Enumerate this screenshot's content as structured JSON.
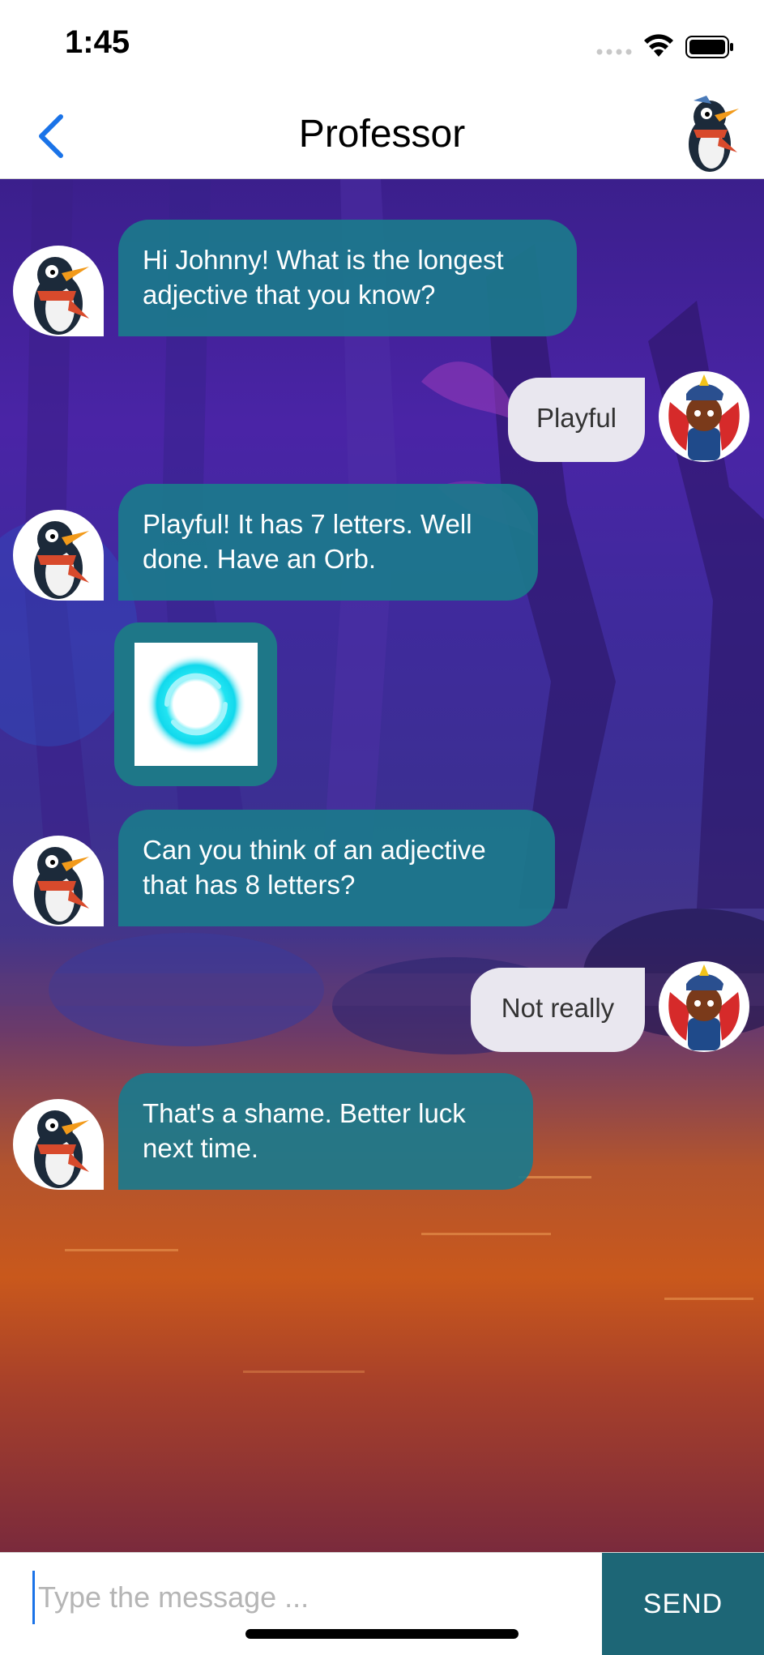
{
  "status_bar": {
    "time": "1:45",
    "icons": [
      "signal-icon",
      "wifi-icon",
      "battery-icon"
    ]
  },
  "nav": {
    "title": "Professor",
    "back_icon": "chevron-left-icon",
    "avatar_icon": "penguin-avatar-icon"
  },
  "messages": [
    {
      "sender": "bot",
      "text": "Hi Johnny! What is the longest adjective that you know?"
    },
    {
      "sender": "user",
      "text": "Playful"
    },
    {
      "sender": "bot",
      "text": "Playful! It has 7 letters. Well done. Have an Orb."
    },
    {
      "sender": "bot",
      "type": "image",
      "image": "orb-icon"
    },
    {
      "sender": "bot",
      "text": "Can you think of an adjective that has 8 letters?"
    },
    {
      "sender": "user",
      "text": "Not really"
    },
    {
      "sender": "bot",
      "text": "That's a shame. Better luck next time."
    }
  ],
  "input": {
    "placeholder": "Type the message ...",
    "value": "",
    "send_label": "SEND"
  },
  "colors": {
    "accent": "#1a73e8",
    "bot_bubble": "#1b7a8c",
    "user_bubble": "#e9e7ef",
    "send_button": "#1d6676"
  }
}
